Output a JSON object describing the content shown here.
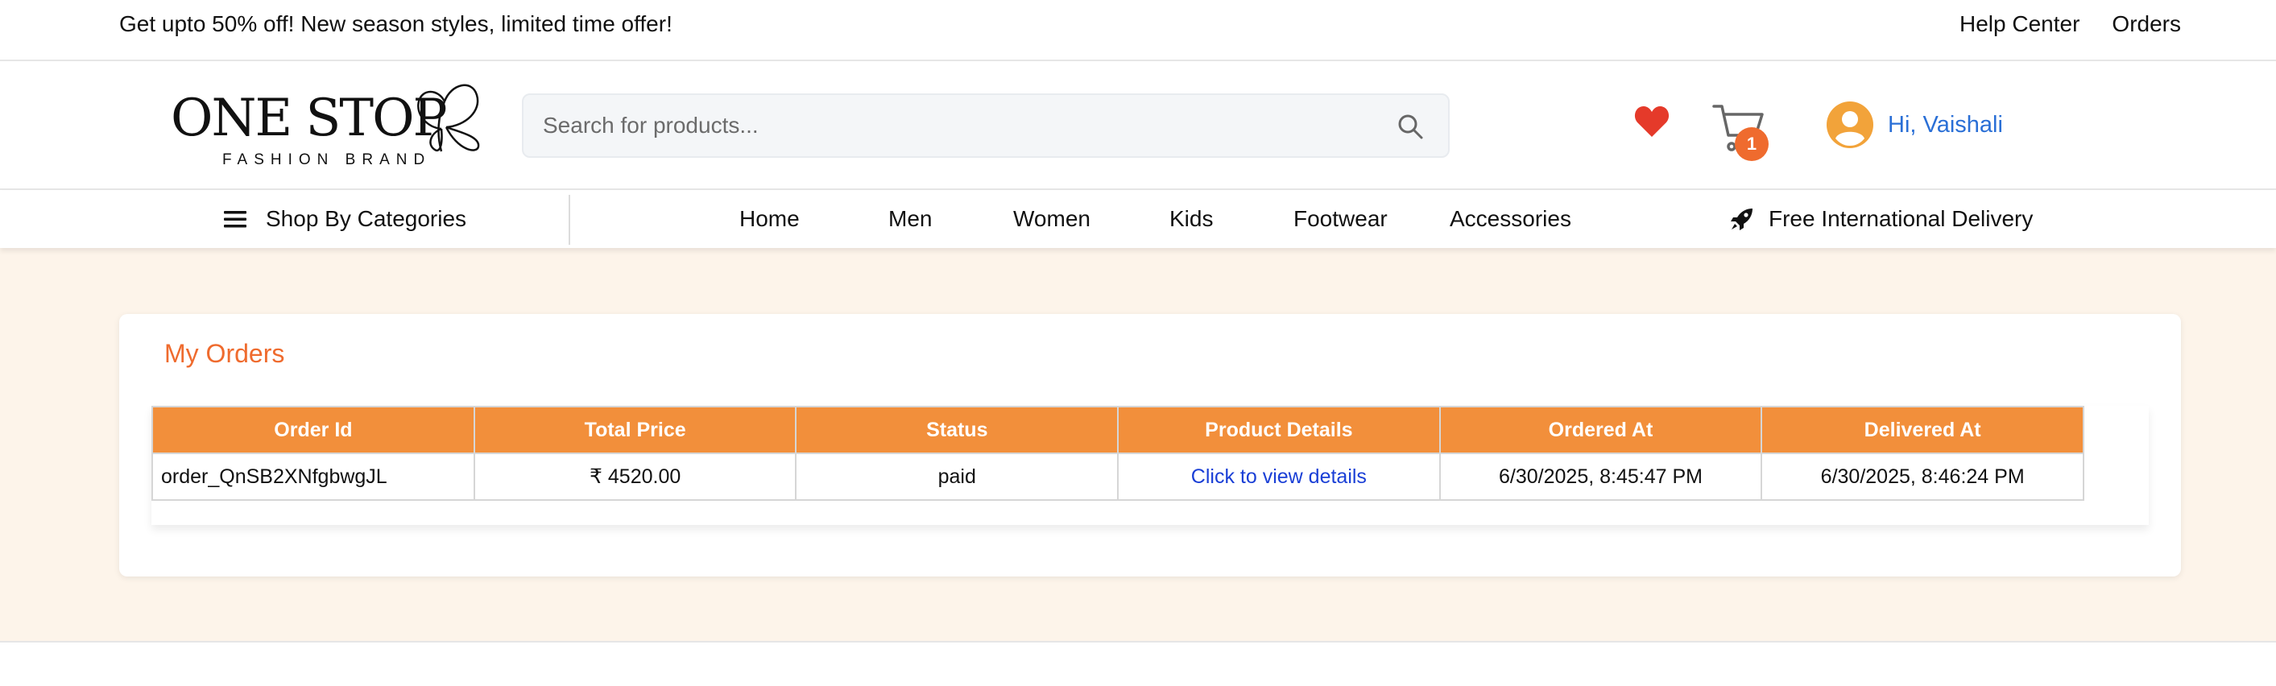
{
  "promo": {
    "text": "Get upto 50% off! New season styles, limited time offer!"
  },
  "top_links": {
    "help": "Help Center",
    "orders": "Orders"
  },
  "logo": {
    "title": "ONE STOP",
    "subtitle": "FASHION BRAND"
  },
  "search": {
    "placeholder": "Search for products...",
    "value": ""
  },
  "header": {
    "cart_count": "1",
    "greeting": "Hi, Vaishali"
  },
  "nav": {
    "categories_label": "Shop By Categories",
    "links": [
      "Home",
      "Men",
      "Women",
      "Kids",
      "Footwear",
      "Accessories"
    ],
    "delivery": "Free International Delivery"
  },
  "orders": {
    "title": "My Orders",
    "columns": [
      "Order Id",
      "Total Price",
      "Status",
      "Product Details",
      "Ordered At",
      "Delivered At"
    ],
    "rows": [
      {
        "order_id": "order_QnSB2XNfgbwgJL",
        "total_price": "₹ 4520.00",
        "status": "paid",
        "details": "Click to view details",
        "ordered_at": "6/30/2025, 8:45:47 PM",
        "delivered_at": "6/30/2025, 8:46:24 PM"
      }
    ]
  },
  "colors": {
    "accent": "#ef6b2e",
    "table_header": "#f28f3b",
    "link": "#1a3fd6",
    "greeting": "#2a6fd6",
    "page_bg": "#fdf4ea",
    "heart": "#e53a2a",
    "avatar": "#f2a33a"
  },
  "icons": [
    "butterfly-icon",
    "search-icon",
    "heart-icon",
    "cart-icon",
    "user-avatar-icon",
    "menu-icon",
    "rocket-icon"
  ]
}
